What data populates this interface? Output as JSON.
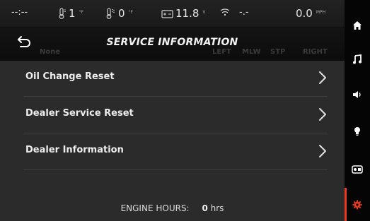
{
  "status_bar": {
    "time": "--:--",
    "temp1": {
      "value": "1",
      "unit": "°F"
    },
    "temp2": {
      "value": "0",
      "unit": "°F"
    },
    "battery": {
      "value": "11.8",
      "unit": "V"
    },
    "signal": {
      "value": "-.-"
    },
    "speed": {
      "value": "0.0",
      "unit": "MPH"
    }
  },
  "header": {
    "title": "SERVICE INFORMATION",
    "back_icon": "back-arrow-icon",
    "ghost_columns": [
      "None",
      "LEFT",
      "MLW",
      "STP",
      "RIGHT"
    ]
  },
  "menu": {
    "items": [
      {
        "label": "Oil Change Reset"
      },
      {
        "label": "Dealer Service Reset"
      },
      {
        "label": "Dealer Information"
      }
    ]
  },
  "footer": {
    "engine_hours_label": "ENGINE HOURS:",
    "engine_hours_value": "0",
    "engine_hours_unit": "hrs"
  },
  "sidebar": {
    "items": [
      {
        "icon": "home-icon",
        "active": false
      },
      {
        "icon": "music-note-icon",
        "active": false
      },
      {
        "icon": "speaker-icon",
        "active": false
      },
      {
        "icon": "light-bulb-icon",
        "active": false
      },
      {
        "icon": "generator-icon",
        "active": false
      },
      {
        "icon": "gear-icon",
        "active": true
      }
    ]
  },
  "colors": {
    "accent": "#e53a1e",
    "list_bg": "#2b2b2b",
    "bar_bg": "#1a1a1a"
  }
}
